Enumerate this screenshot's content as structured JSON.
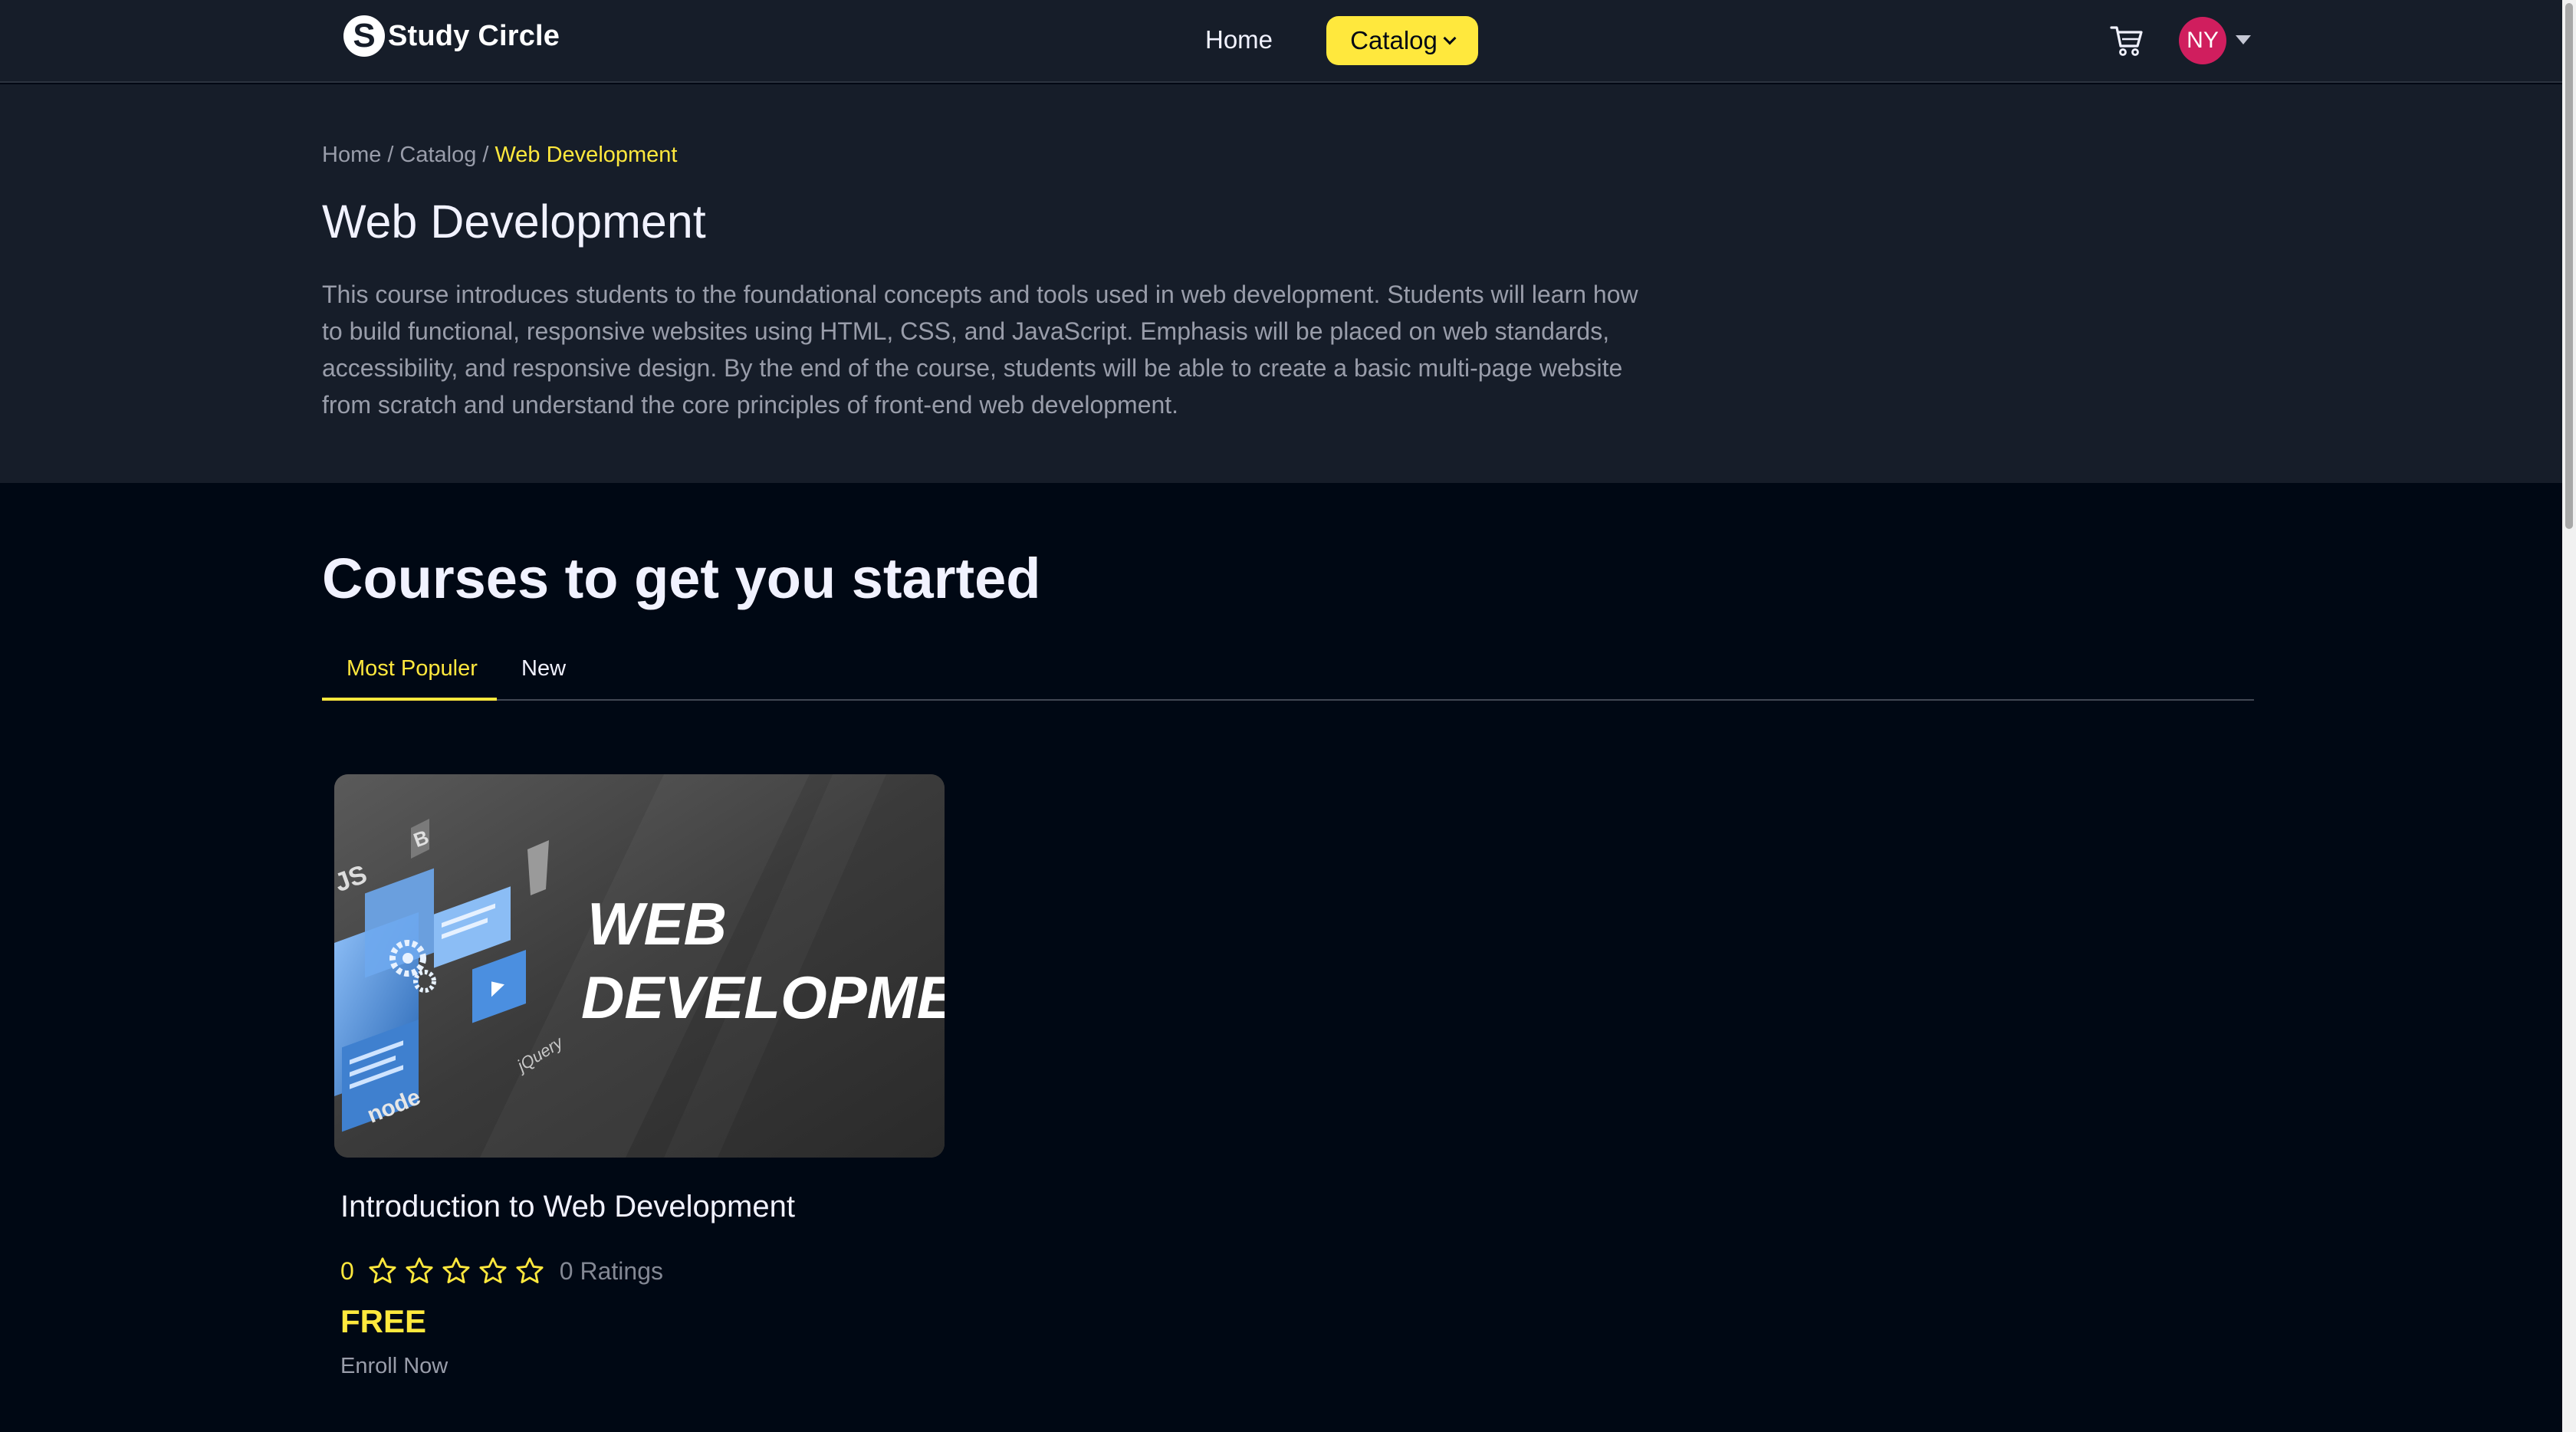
{
  "nav": {
    "brand_mark": "S",
    "brand_name": "Study Circle",
    "home_label": "Home",
    "catalog_label": "Catalog",
    "cart_icon": "cart-icon",
    "avatar_initials": "NY",
    "colors": {
      "nav_bg": "#161d29",
      "accent": "#ffe83d",
      "avatar_bg": "#d01e5e"
    }
  },
  "breadcrumb": {
    "items": [
      "Home",
      "Catalog"
    ],
    "separator": "/",
    "current": "Web Development"
  },
  "category": {
    "title": "Web Development",
    "description": "This course introduces students to the foundational concepts and tools used in web development. Students will learn how to build functional, responsive websites using HTML, CSS, and JavaScript. Emphasis will be placed on web standards, accessibility, and responsive design. By the end of the course, students will be able to create a basic multi-page website from scratch and understand the core principles of front-end web development."
  },
  "courses": {
    "section_title": "Courses to get you started",
    "tabs": [
      {
        "label": "Most Populer",
        "active": true
      },
      {
        "label": "New",
        "active": false
      }
    ],
    "cards": [
      {
        "thumbnail_text_line1": "WEB",
        "thumbnail_text_line2": "DEVELOPMENT",
        "thumbnail_logos": [
          "JS",
          "B",
          "jQuery",
          "node"
        ],
        "title": "Introduction to Web Development",
        "rating": "0",
        "stars_filled": 0,
        "stars_total": 5,
        "ratings_label": "0 Ratings",
        "price": "FREE",
        "enroll_label": "Enroll Now"
      }
    ]
  }
}
